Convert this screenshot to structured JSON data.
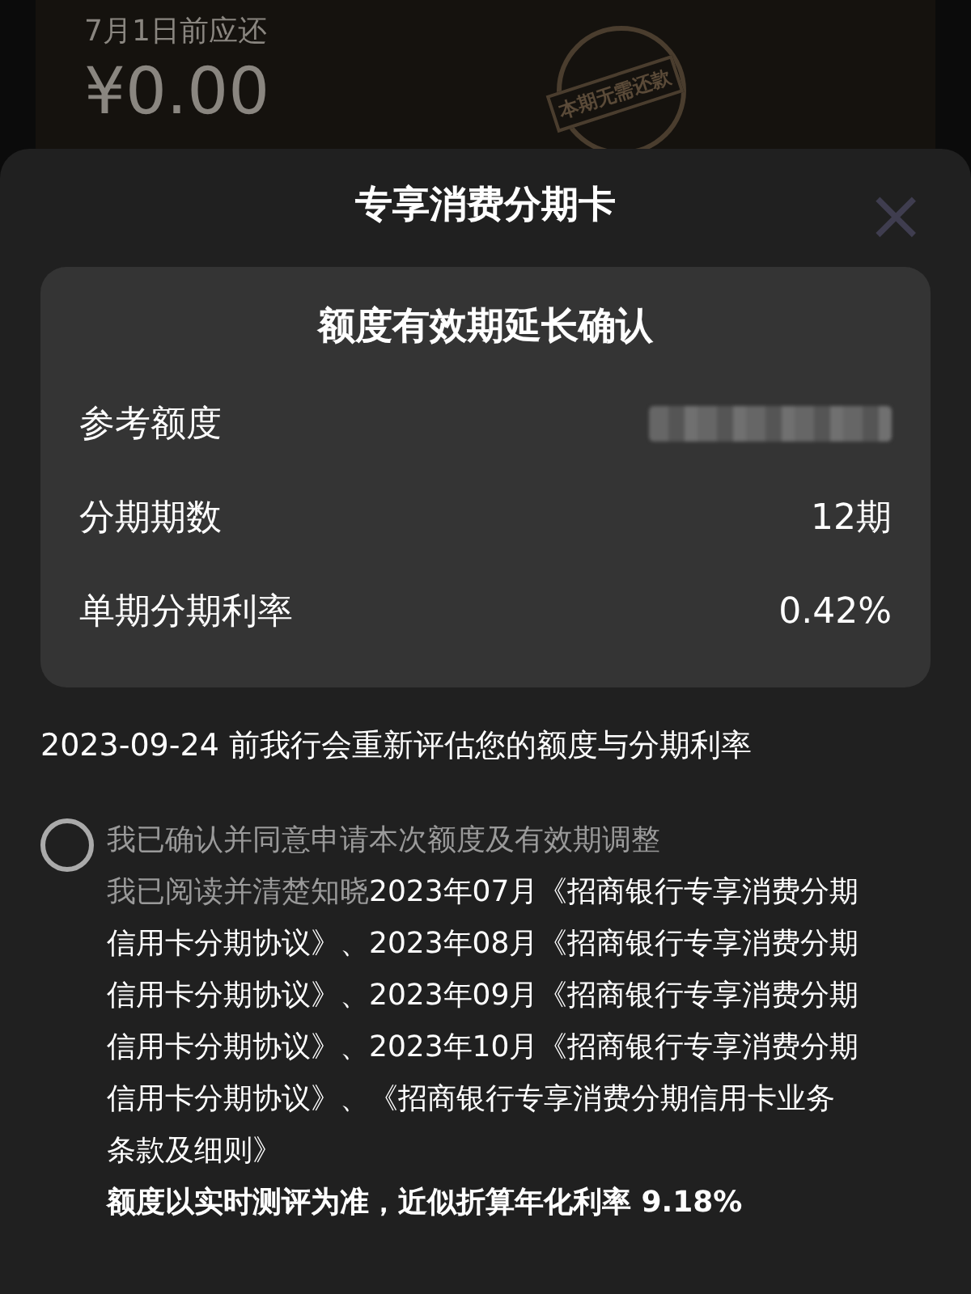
{
  "bill_card": {
    "due_label": "7月1日前应还",
    "amount": "¥0.00",
    "stamp": "本期无需还款"
  },
  "dialog": {
    "title": "专享消费分期卡",
    "close": "×",
    "summary": {
      "title": "额度有效期延长确认",
      "rows": [
        {
          "label": "参考额度",
          "kind": "redacted"
        },
        {
          "label": "分期期数",
          "kind": "text",
          "value": "12期"
        },
        {
          "label": "单期分期利率",
          "kind": "text",
          "value": "0.42%"
        }
      ]
    },
    "notice": "2023-09-24 前我行会重新评估您的额度与分期利率",
    "consent": {
      "checked": false,
      "label": "我已确认并同意申请本次额度及有效期调整",
      "intro": "我已阅读并清楚知晓",
      "agreements": "2023年07月《招商银行专享消费分期信用卡分期协议》、2023年08月《招商银行专享消费分期信用卡分期协议》、2023年09月《招商银行专享消费分期信用卡分期协议》、2023年10月《招商银行专享消费分期信用卡分期协议》、《招商银行专享消费分期信用卡业务条款及细则》",
      "footnote": "额度以实时测评为准，近似折算年化利率 9.18%"
    }
  }
}
